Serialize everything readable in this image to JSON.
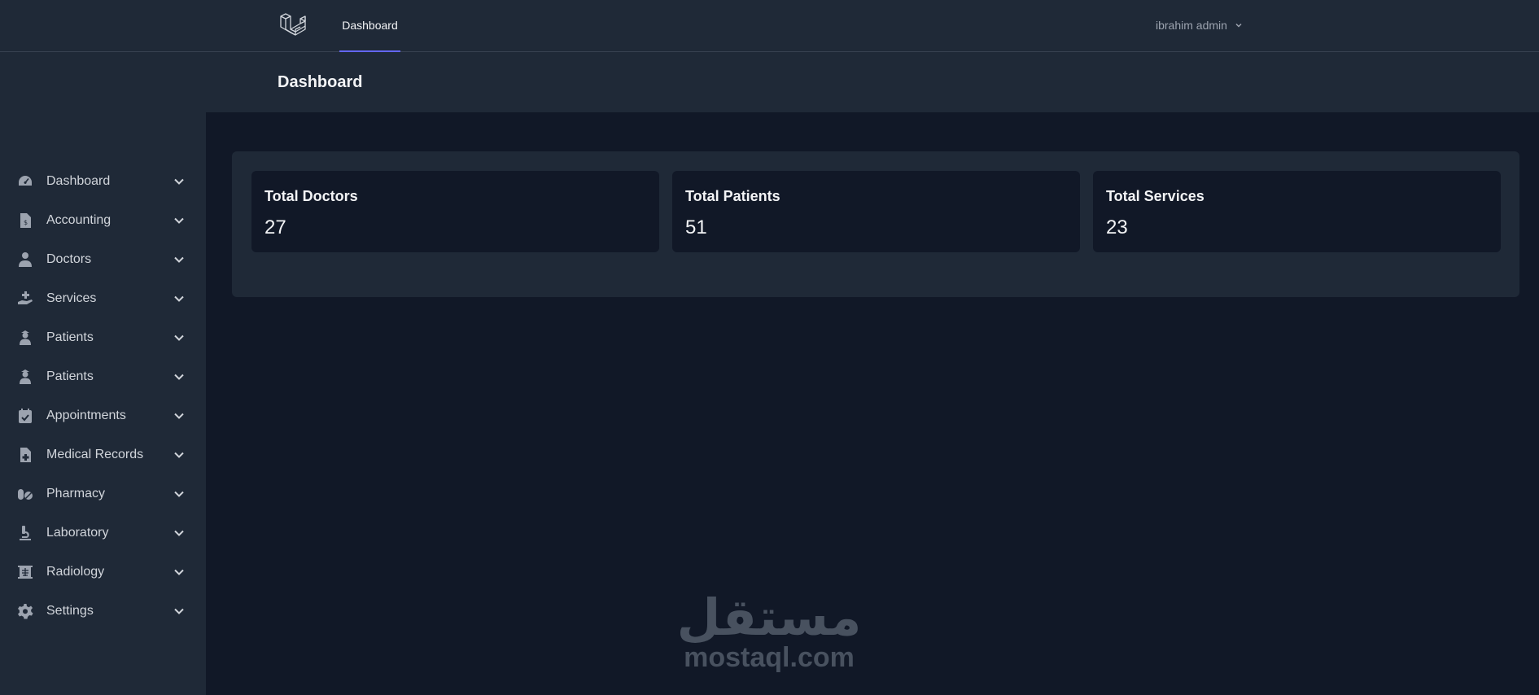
{
  "topnav": {
    "brand_icon": "laravel-logo-icon",
    "links": [
      {
        "label": "Dashboard",
        "active": true
      }
    ],
    "user_name": "ibrahim admin"
  },
  "header": {
    "title": "Dashboard"
  },
  "sidebar": {
    "items": [
      {
        "label": "Dashboard",
        "icon": "gauge-icon"
      },
      {
        "label": "Accounting",
        "icon": "invoice-icon"
      },
      {
        "label": "Doctors",
        "icon": "doctor-icon"
      },
      {
        "label": "Services",
        "icon": "hand-service-icon"
      },
      {
        "label": "Patients",
        "icon": "patient-icon"
      },
      {
        "label": "Patients",
        "icon": "patient-icon"
      },
      {
        "label": "Appointments",
        "icon": "calendar-check-icon"
      },
      {
        "label": "Medical Records",
        "icon": "file-medical-icon"
      },
      {
        "label": "Pharmacy",
        "icon": "pills-icon"
      },
      {
        "label": "Laboratory",
        "icon": "microscope-icon"
      },
      {
        "label": "Radiology",
        "icon": "x-ray-icon"
      },
      {
        "label": "Settings",
        "icon": "gear-icon"
      }
    ]
  },
  "stats": [
    {
      "title": "Total Doctors",
      "value": "27"
    },
    {
      "title": "Total Patients",
      "value": "51"
    },
    {
      "title": "Total Services",
      "value": "23"
    }
  ],
  "watermark": {
    "arabic": "مستقل",
    "latin": "mostaql.com"
  },
  "colors": {
    "nav_bg": "#1f2937",
    "page_bg": "#111827",
    "accent": "#6366f1",
    "text": "#f3f4f6",
    "muted": "#9ca3af"
  }
}
